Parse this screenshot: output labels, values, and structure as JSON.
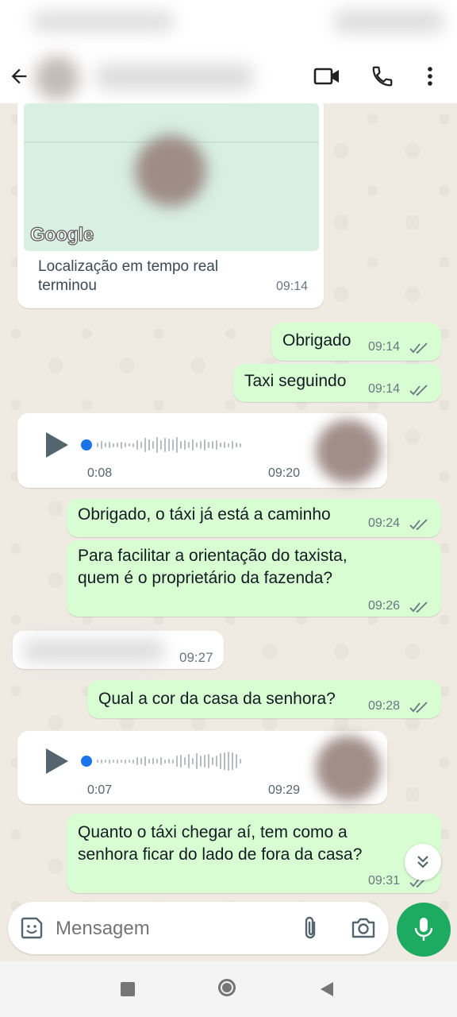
{
  "header": {
    "back_icon": "arrow-left-icon",
    "video_icon": "video-camera-icon",
    "call_icon": "phone-icon",
    "menu_icon": "more-vertical-icon"
  },
  "messages": {
    "location": {
      "map_brand": "Google",
      "caption_line1": "Localização em tempo real",
      "caption_line2": "terminou",
      "time": "09:14"
    },
    "m1": {
      "text": "Obrigado",
      "time": "09:14"
    },
    "m2": {
      "text": "Taxi seguindo",
      "time": "09:14"
    },
    "audio1": {
      "duration": "0:08",
      "time": "09:20"
    },
    "m3": {
      "text": "Obrigado, o táxi já está a caminho",
      "time": "09:24"
    },
    "m4": {
      "line1": "Para facilitar a orientação do taxista,",
      "line2": "quem é o proprietário da fazenda?",
      "time": "09:26"
    },
    "m5_in": {
      "time": "09:27"
    },
    "m6": {
      "text": "Qual a cor da casa da senhora?",
      "time": "09:28"
    },
    "audio2": {
      "duration": "0:07",
      "time": "09:29"
    },
    "m7": {
      "line1": "Quanto o táxi chegar aí, tem como a",
      "line2": "senhora ficar do lado de fora da casa?",
      "time": "09:31"
    }
  },
  "composer": {
    "placeholder": "Mensagem",
    "emoji_icon": "sticker-icon",
    "attach_icon": "paperclip-icon",
    "camera_icon": "camera-icon",
    "mic_icon": "microphone-icon"
  },
  "colors": {
    "outgoing_bubble": "#d9fdd3",
    "incoming_bubble": "#ffffff",
    "accent_green": "#1daa61",
    "read_ticks": "#667781",
    "audio_dot": "#1a73e8"
  }
}
